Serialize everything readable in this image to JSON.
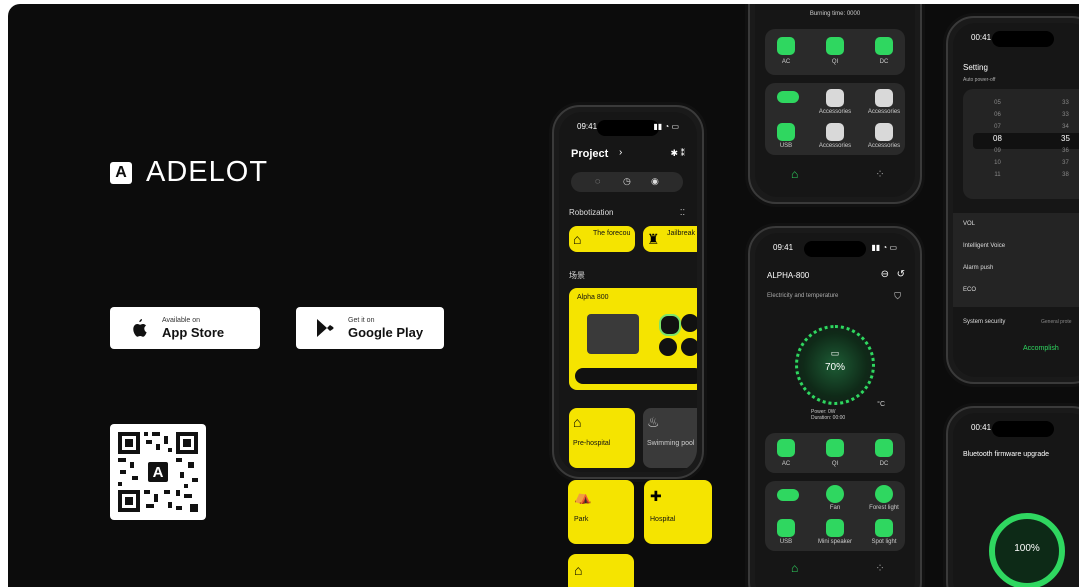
{
  "brand": {
    "name": "ADELOT",
    "mark": "A"
  },
  "app_store": {
    "line1": "Available on",
    "line2": "App Store"
  },
  "google_play": {
    "line1": "Get it on",
    "line2": "Google Play"
  },
  "phone1": {
    "time": "09:41",
    "title": "Project",
    "section1": "Robotization",
    "tile1": "The forecou",
    "tile2": "Jailbreak",
    "section2": "场景",
    "device_card": "Alpha 800",
    "scene1": "Pre-hospital",
    "scene2": "Swimming pool",
    "scene3": "Park",
    "scene4": "Hospital"
  },
  "phone2": {
    "status": "Burning time: 0000",
    "btns": [
      "AC",
      "QI",
      "DC"
    ],
    "row2": [
      "Accessories",
      "Accessories"
    ],
    "row3": [
      "USB",
      "Accessories",
      "Accessories"
    ]
  },
  "phone3": {
    "time": "09:41",
    "title": "ALPHA-800",
    "subtitle": "Electricity and temperature",
    "battery": "70%",
    "unit": "°C",
    "power_line1": "Power: 0W",
    "power_line2": "Duration: 00:00",
    "btns": [
      "AC",
      "QI",
      "DC"
    ],
    "row2": [
      "Fan",
      "Forest light"
    ],
    "row3": [
      "USB",
      "Mini speaker",
      "Spot light"
    ]
  },
  "phone4": {
    "time": "00:41",
    "title": "Setting",
    "subtitle": "Auto power-off",
    "hours": [
      "05",
      "06",
      "07",
      "08",
      "09",
      "10",
      "11"
    ],
    "minutes": [
      "33",
      "33",
      "34",
      "35",
      "36",
      "37",
      "38"
    ],
    "rows": [
      "VOL",
      "Intelligent Voice",
      "Alarm push",
      "ECO"
    ],
    "security": "System security",
    "security_val": "General prote",
    "accomplish": "Accomplish"
  },
  "phone5": {
    "time": "00:41",
    "title": "Bluetooth firmware upgrade",
    "progress": "100%"
  }
}
